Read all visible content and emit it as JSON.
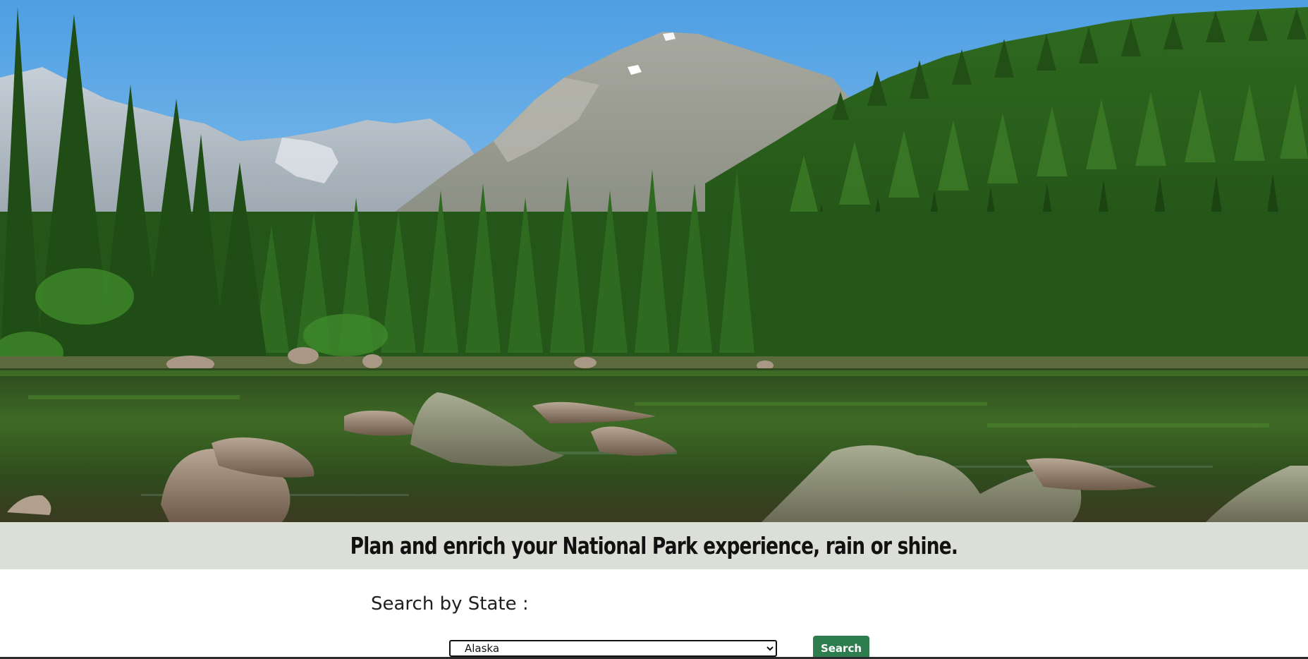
{
  "hero": {
    "image_name": "mountain-lake-forest-photo"
  },
  "tagline": {
    "text": "Plan and enrich your National Park experience, rain or shine."
  },
  "search": {
    "heading": "Search by State :",
    "selected_state": "Alaska",
    "button_label": "Search"
  },
  "colors": {
    "band_background": "#dcdfd7",
    "button_background": "#2e7d4f",
    "button_text": "#ffffff"
  }
}
